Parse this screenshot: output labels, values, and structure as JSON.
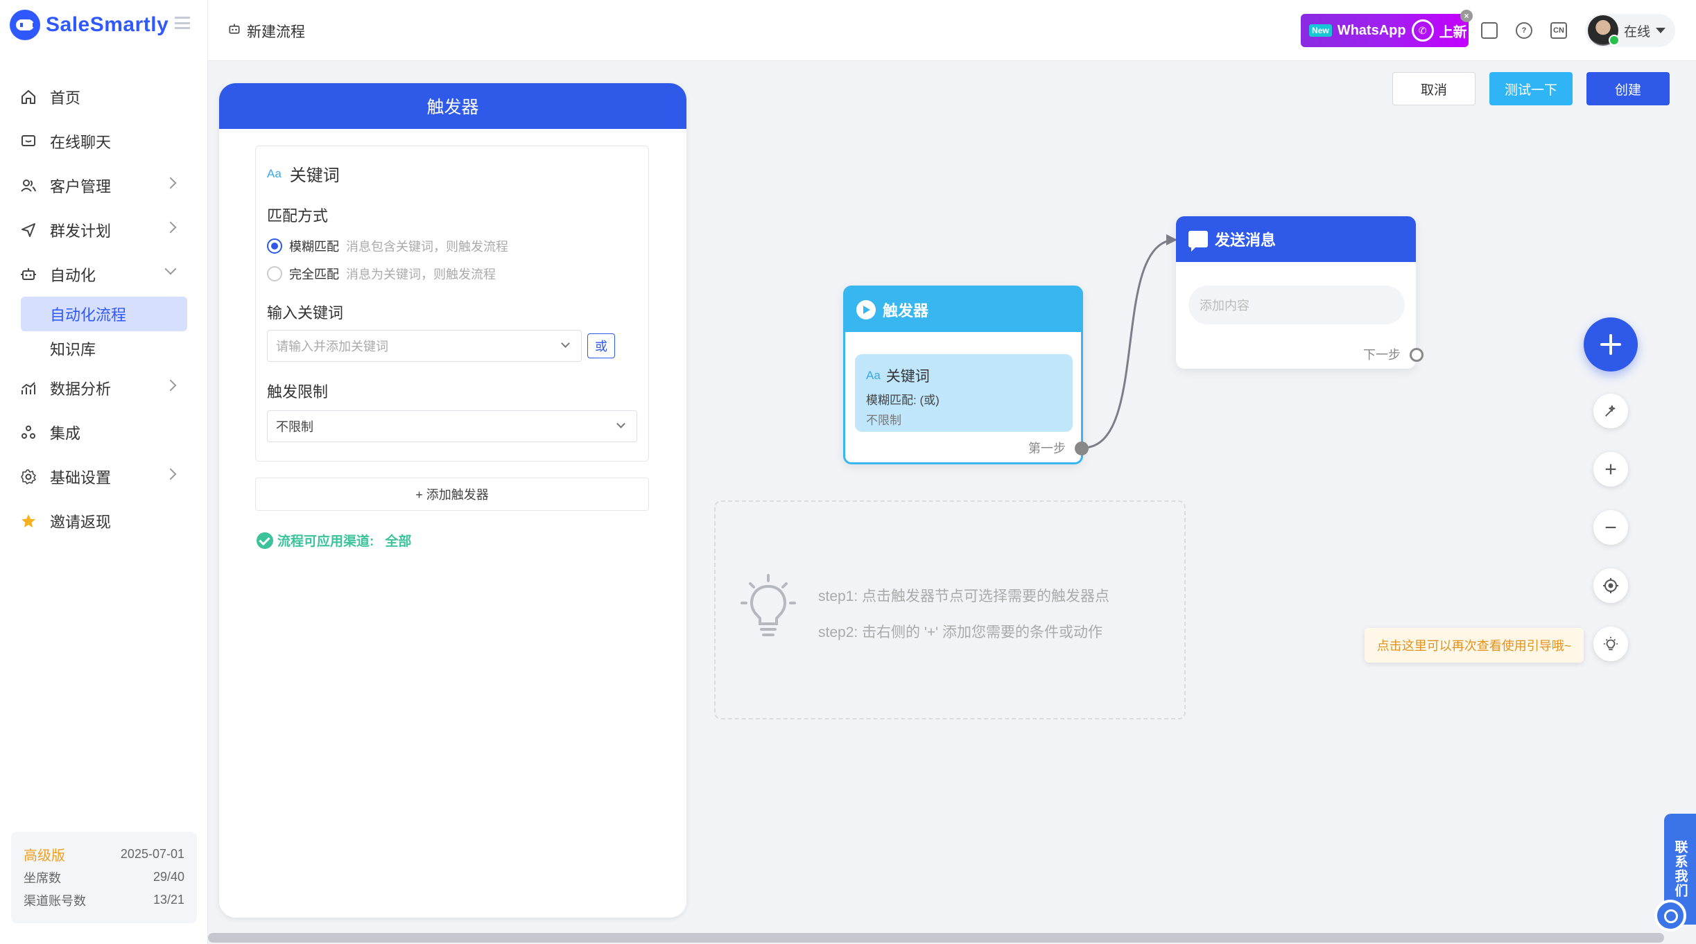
{
  "app": {
    "brand": "SaleSmartly"
  },
  "sidebar": {
    "items": [
      {
        "label": "首页",
        "icon": "home-icon"
      },
      {
        "label": "在线聊天",
        "icon": "chat-icon"
      },
      {
        "label": "客户管理",
        "icon": "users-icon"
      },
      {
        "label": "群发计划",
        "icon": "send-icon"
      },
      {
        "label": "自动化",
        "icon": "robot-icon"
      },
      {
        "label": "数据分析",
        "icon": "chart-icon"
      },
      {
        "label": "集成",
        "icon": "integration-icon"
      },
      {
        "label": "基础设置",
        "icon": "gear-icon"
      },
      {
        "label": "邀请返现",
        "icon": "star-icon"
      }
    ],
    "sub_items": [
      "自动化流程",
      "知识库"
    ],
    "plan": {
      "name": "高级版",
      "expiry": "2025-07-01",
      "seats_label": "坐席数",
      "seats_value": "29/40",
      "channels_label": "渠道账号数",
      "channels_value": "13/21"
    }
  },
  "header": {
    "breadcrumb": "新建流程",
    "promo": {
      "new": "New",
      "text": "WhatsApp",
      "suffix": "上新"
    },
    "icons": [
      "tablet-icon",
      "help-icon",
      "language-icon"
    ],
    "lang": "CN",
    "status": "在线"
  },
  "panel": {
    "title": "触发器",
    "card_title": "关键词",
    "match_label": "匹配方式",
    "match_options": [
      {
        "label": "模糊匹配",
        "desc": "消息包含关键词，则触发流程",
        "selected": true
      },
      {
        "label": "完全匹配",
        "desc": "消息为关键词，则触发流程",
        "selected": false
      }
    ],
    "keyword_label": "输入关键词",
    "keyword_placeholder": "请输入并添加关键词",
    "or_label": "或",
    "limit_label": "触发限制",
    "limit_value": "不限制",
    "add_trigger": "+ 添加触发器",
    "channel_label": "流程可应用渠道:",
    "channel_value": "全部"
  },
  "canvas": {
    "actions": {
      "cancel": "取消",
      "test": "测试一下",
      "create": "创建"
    },
    "trigger_node": {
      "title": "触发器",
      "keyword_title": "关键词",
      "match_text": "模糊匹配: (或)",
      "limit_text": "不限制",
      "step": "第一步"
    },
    "send_node": {
      "title": "发送消息",
      "placeholder": "添加内容",
      "step": "下一步"
    },
    "guide": {
      "step1": "step1: 点击触发器节点可选择需要的触发器点",
      "step2": "step2: 击右侧的 '+' 添加您需要的条件或动作"
    },
    "tip": "点击这里可以再次查看使用引导哦~",
    "contact": "联系我们"
  }
}
